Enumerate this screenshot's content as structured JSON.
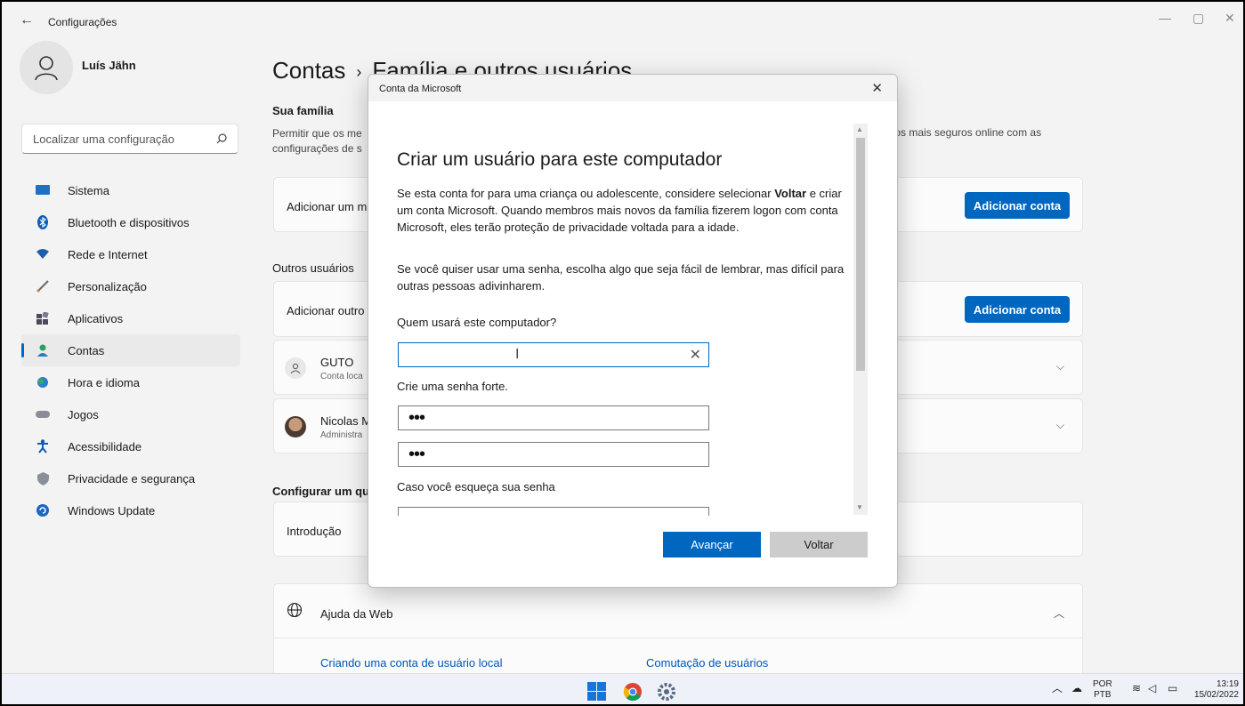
{
  "window": {
    "back_glyph": "←",
    "title": "Configurações",
    "minimize": "—",
    "maximize": "▢",
    "close": "✕"
  },
  "sidebar": {
    "user_name": "Luís Jähn",
    "search_placeholder": "Localizar uma configuração",
    "items": [
      {
        "label": "Sistema",
        "icon": "monitor-icon"
      },
      {
        "label": "Bluetooth e dispositivos",
        "icon": "bluetooth-icon"
      },
      {
        "label": "Rede e Internet",
        "icon": "wifi-icon"
      },
      {
        "label": "Personalização",
        "icon": "brush-icon"
      },
      {
        "label": "Aplicativos",
        "icon": "apps-icon"
      },
      {
        "label": "Contas",
        "icon": "accounts-icon"
      },
      {
        "label": "Hora e idioma",
        "icon": "globe-clock-icon"
      },
      {
        "label": "Jogos",
        "icon": "gamepad-icon"
      },
      {
        "label": "Acessibilidade",
        "icon": "accessibility-icon"
      },
      {
        "label": "Privacidade e segurança",
        "icon": "shield-icon"
      },
      {
        "label": "Windows Update",
        "icon": "update-icon"
      }
    ]
  },
  "main": {
    "breadcrumb_parent": "Contas",
    "breadcrumb_sep": "›",
    "breadcrumb_current": "Família e outros usuários",
    "family_section": "Sua família",
    "family_desc_line1": "Permitir que os me",
    "family_desc_line2": "configurações de s",
    "family_desc_right": "ɔs mais seguros online com as",
    "add_member_label": "Adicionar um m",
    "add_account_button": "Adicionar conta",
    "other_users_section": "Outros usuários",
    "add_other_label": "Adicionar outro",
    "add_account_button_2": "Adicionar conta",
    "users": [
      {
        "name": "GUTO",
        "sub": "Conta loca"
      },
      {
        "name": "Nicolas M",
        "sub": "Administra"
      }
    ],
    "kiosk_section": "Configurar um qui",
    "intro_label": "Introdução",
    "web_help": "Ajuda da Web",
    "links": [
      "Criando uma conta de usuário local",
      "Comutação de usuários"
    ]
  },
  "dialog": {
    "title": "Conta da Microsoft",
    "close": "✕",
    "heading": "Criar um usuário para este computador",
    "para1_before": "Se esta conta for para uma criança ou adolescente, considere selecionar ",
    "para1_bold": "Voltar",
    "para1_after": " e criar um conta Microsoft. Quando membros mais novos da família fizerem logon com conta Microsoft, eles terão proteção de privacidade voltada para a idade.",
    "para2": "Se você quiser usar uma senha, escolha algo que seja fácil de lembrar, mas difícil para outras pessoas adivinharem.",
    "who_label": "Quem usará este computador?",
    "username_value": "",
    "password_label": "Crie uma senha forte.",
    "password_mask": "•••",
    "confirm_mask": "•••",
    "forgot_label": "Caso você esqueça sua senha",
    "next_button": "Avançar",
    "back_button": "Voltar"
  },
  "taskbar": {
    "lang_top": "POR",
    "lang_bottom": "PTB",
    "time": "13:19",
    "date": "15/02/2022"
  },
  "colors": {
    "accent": "#0067c0",
    "window_bg": "#f3f3f3"
  }
}
